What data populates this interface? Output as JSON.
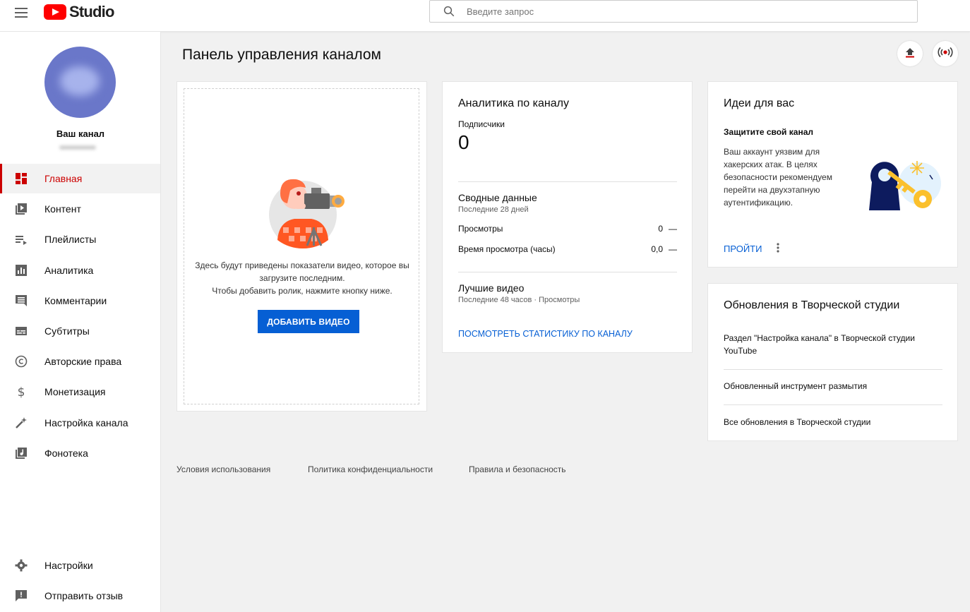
{
  "app": {
    "logo_text": "Studio"
  },
  "search": {
    "placeholder": "Введите запрос"
  },
  "channel": {
    "name": "Ваш канал"
  },
  "sidebar": {
    "items": [
      {
        "label": "Главная",
        "icon": "dashboard-icon",
        "active": true
      },
      {
        "label": "Контент",
        "icon": "video-library-icon"
      },
      {
        "label": "Плейлисты",
        "icon": "playlist-icon"
      },
      {
        "label": "Аналитика",
        "icon": "bar-chart-icon"
      },
      {
        "label": "Комментарии",
        "icon": "comment-icon"
      },
      {
        "label": "Субтитры",
        "icon": "subtitles-icon"
      },
      {
        "label": "Авторские права",
        "icon": "copyright-icon"
      },
      {
        "label": "Монетизация",
        "icon": "dollar-icon"
      },
      {
        "label": "Настройка канала",
        "icon": "magic-wand-icon"
      },
      {
        "label": "Фонотека",
        "icon": "audio-library-icon"
      }
    ],
    "bottom": [
      {
        "label": "Настройки",
        "icon": "gear-icon"
      },
      {
        "label": "Отправить отзыв",
        "icon": "feedback-icon"
      }
    ]
  },
  "main": {
    "title": "Панель управления каналом",
    "upload_card": {
      "line1": "Здесь будут приведены показатели видео, которое вы",
      "line2": "загрузите последним.",
      "line3": "Чтобы добавить ролик, нажмите кнопку ниже.",
      "button": "ДОБАВИТЬ ВИДЕО"
    },
    "analytics": {
      "title": "Аналитика по каналу",
      "subs_label": "Подписчики",
      "subs_value": "0",
      "summary_title": "Сводные данные",
      "summary_period": "Последние 28 дней",
      "views_label": "Просмотры",
      "views_value": "0",
      "views_trend": "—",
      "watch_label": "Время просмотра (часы)",
      "watch_value": "0,0",
      "watch_trend": "—",
      "top_title": "Лучшие видео",
      "top_period": "Последние 48 часов · Просмотры",
      "link": "ПОСМОТРЕТЬ СТАТИСТИКУ ПО КАНАЛУ"
    },
    "ideas": {
      "title": "Идеи для вас",
      "subtitle": "Защитите свой канал",
      "body": [
        "Ваш аккаунт уязвим для",
        "хакерских атак. В целях",
        "безопасности рекомендуем",
        "перейти на двухэтапную",
        "аутентификацию."
      ],
      "link": "ПРОЙТИ"
    },
    "updates": {
      "title": "Обновления в Творческой студии",
      "item1a": "Раздел \"Настройка канала\" в Творческой студии",
      "item1b": "YouTube",
      "item2": "Обновленный инструмент размытия",
      "item3": "Все обновления в Творческой студии"
    }
  },
  "footer": {
    "terms": "Условия использования",
    "privacy": "Политика конфиденциальности",
    "safety": "Правила и безопасность"
  },
  "colors": {
    "accent": "#cc0000",
    "link": "#065fd4",
    "brand": "#ff0000"
  }
}
